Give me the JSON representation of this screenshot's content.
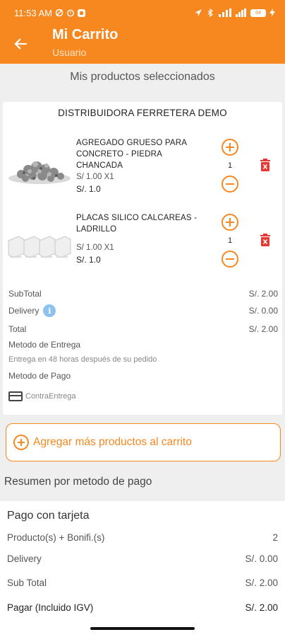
{
  "status_bar": {
    "time": "11:53 AM",
    "battery": "64"
  },
  "app_bar": {
    "title": "Mi Carrito",
    "subtitle": "Usuario"
  },
  "section_title": "Mis productos seleccionados",
  "store": {
    "name": "DISTRIBUIDORA FERRETERA DEMO",
    "products": [
      {
        "name": "AGREGADO GRUESO PARA CONCRETO - PIEDRA CHANCADA",
        "price_line": "S/ 1.00 X1",
        "total": "S/. 1.0",
        "quantity": "1",
        "image_icon": "gravel-image"
      },
      {
        "name": "PLACAS SILICO CALCAREAS - LADRILLO",
        "price_line": "S/ 1.00 X1",
        "total": "S/. 1.0",
        "quantity": "1",
        "image_icon": "bricks-image"
      }
    ],
    "subtotal_label": "SubTotal",
    "subtotal_value": "S/. 2.00",
    "delivery_label": "Delivery",
    "delivery_value": "S/. 0.00",
    "total_label": "Total",
    "total_value": "S/. 2.00",
    "delivery_method_label": "Metodo de Entrega",
    "delivery_method_note": "Entrega en 48 horas después de su pedido",
    "payment_method_label": "Metodo de Pago",
    "payment_method_value": "ContraEntrega"
  },
  "add_more_label": "Agregar más productos al carrito",
  "summary": {
    "title": "Resumen por metodo de pago",
    "card_title": "Pago con tarjeta",
    "rows": [
      {
        "label": "Producto(s) + Bonifi.(s)",
        "value": "2"
      },
      {
        "label": "Delivery",
        "value": "S/. 0.00"
      },
      {
        "label": "Sub Total",
        "value": "S/. 2.00"
      },
      {
        "label": "Pagar (Incluido IGV)",
        "value": "S/. 2.00"
      }
    ]
  },
  "colors": {
    "accent": "#f7871f",
    "danger": "#e53935",
    "info": "#8ec2ee"
  }
}
